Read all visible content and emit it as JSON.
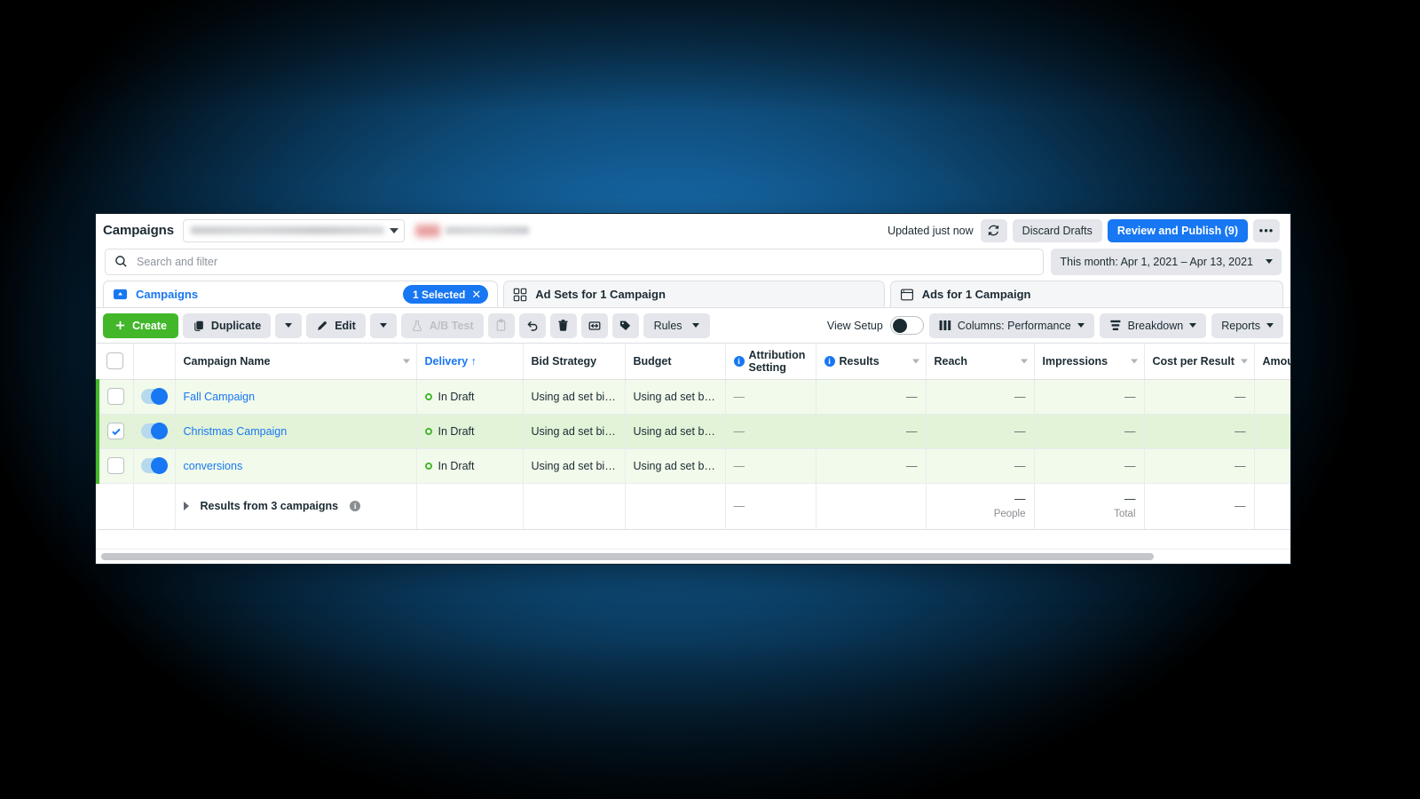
{
  "window": {
    "topbar": {
      "app_title": "Campaigns",
      "account_select_placeholder": "",
      "updated_text": "Updated just now",
      "refresh_icon": "refresh-icon",
      "discard_label": "Discard Drafts",
      "publish_label": "Review and Publish (9)",
      "more_label": "•••"
    },
    "search": {
      "placeholder": "Search and filter",
      "search_icon": "search-icon",
      "date_range": "This month: Apr 1, 2021 – Apr 13, 2021"
    },
    "tabs": [
      {
        "label": "Campaigns",
        "icon": "campaign-folder-icon",
        "active": true,
        "badge": "1 Selected",
        "badge_close": "✕"
      },
      {
        "label": "Ad Sets for 1 Campaign",
        "icon": "adsets-grid-icon",
        "active": false
      },
      {
        "label": "Ads for 1 Campaign",
        "icon": "ads-window-icon",
        "active": false
      }
    ],
    "toolbar": {
      "create_label": "Create",
      "create_icon": "plus-icon",
      "duplicate_label": "Duplicate",
      "duplicate_icon": "copy-icon",
      "edit_label": "Edit",
      "edit_icon": "pencil-icon",
      "abtest_label": "A/B Test",
      "abtest_icon": "flask-icon",
      "clipboard_icon": "clipboard-icon",
      "undo_icon": "undo-icon",
      "delete_icon": "trash-icon",
      "export_icon": "export-icon",
      "tag_icon": "tag-icon",
      "rules_label": "Rules",
      "view_setup_label": "View Setup",
      "view_setup_state": "off",
      "columns_label": "Columns: Performance",
      "columns_icon": "columns-icon",
      "breakdown_label": "Breakdown",
      "breakdown_icon": "breakdown-icon",
      "reports_label": "Reports"
    },
    "table": {
      "columns": [
        {
          "label": "Campaign Name",
          "sorted": false,
          "menu": true
        },
        {
          "label": "Delivery ↑",
          "sorted": true,
          "menu": false
        },
        {
          "label": "Bid Strategy",
          "sorted": false,
          "menu": false
        },
        {
          "label": "Budget",
          "sorted": false,
          "menu": false
        },
        {
          "label": "Attribution Setting",
          "sorted": false,
          "menu": false,
          "info": true
        },
        {
          "label": "Results",
          "sorted": false,
          "menu": true,
          "info": true
        },
        {
          "label": "Reach",
          "sorted": false,
          "menu": true
        },
        {
          "label": "Impressions",
          "sorted": false,
          "menu": true
        },
        {
          "label": "Cost per Result",
          "sorted": false,
          "menu": true
        },
        {
          "label": "Amoun",
          "sorted": false,
          "menu": false
        }
      ],
      "rows": [
        {
          "selected": false,
          "toggle": "on",
          "name": "Fall Campaign",
          "delivery": "In Draft",
          "bid_strategy": "Using ad set bid...",
          "budget": "Using ad set bu...",
          "attribution": "—",
          "results": "—",
          "reach": "—",
          "impressions": "—",
          "cost_per_result": "—",
          "amount": ""
        },
        {
          "selected": true,
          "toggle": "on",
          "name": "Christmas Campaign",
          "delivery": "In Draft",
          "bid_strategy": "Using ad set bid...",
          "budget": "Using ad set bu...",
          "attribution": "—",
          "results": "—",
          "reach": "—",
          "impressions": "—",
          "cost_per_result": "—",
          "amount": ""
        },
        {
          "selected": false,
          "toggle": "on",
          "name": "conversions",
          "delivery": "In Draft",
          "bid_strategy": "Using ad set bid...",
          "budget": "Using ad set bu...",
          "attribution": "—",
          "results": "—",
          "reach": "—",
          "impressions": "—",
          "cost_per_result": "—",
          "amount": ""
        }
      ],
      "summary": {
        "label": "Results from 3 campaigns",
        "attribution": "—",
        "results": "",
        "reach_value": "—",
        "reach_sub": "People",
        "impressions_value": "—",
        "impressions_sub": "Total",
        "cost_per_result": "—"
      }
    },
    "colors": {
      "brand_blue": "#1877f2",
      "create_green": "#42b72a",
      "draft_row": "#f1faeb",
      "selected_row": "#e2f3d8"
    }
  }
}
